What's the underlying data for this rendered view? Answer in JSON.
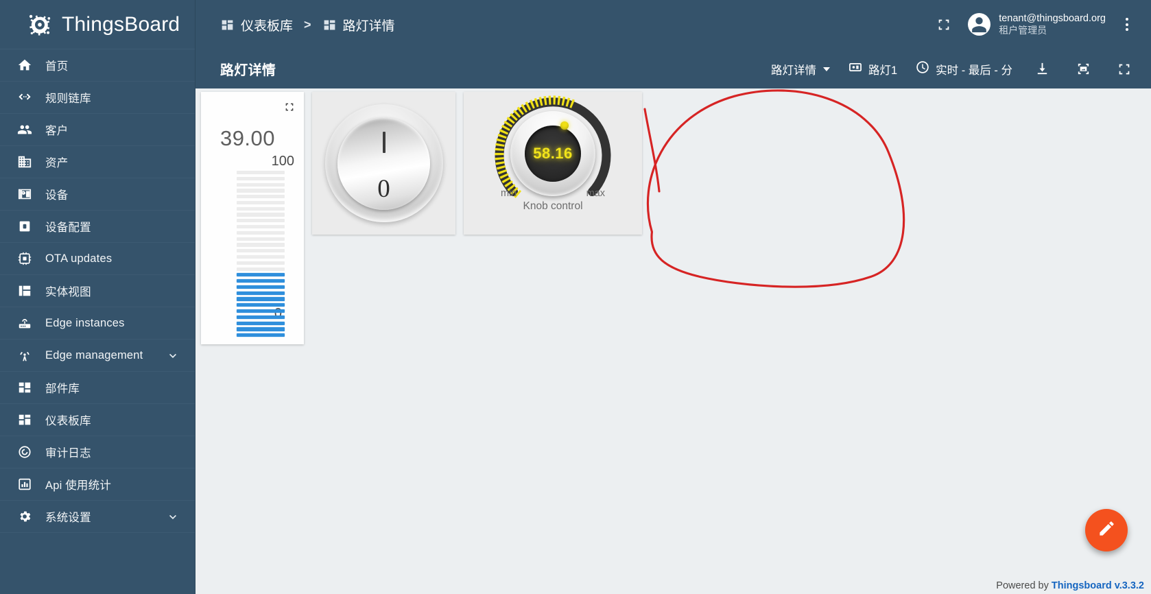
{
  "brand": {
    "name": "ThingsBoard",
    "logo_icon": "thingsboard-gear-logo"
  },
  "sidebar": {
    "items": [
      {
        "label": "首页",
        "icon": "home-icon",
        "expandable": false
      },
      {
        "label": "规则链库",
        "icon": "rule-chain-icon",
        "expandable": false
      },
      {
        "label": "客户",
        "icon": "customers-people-icon",
        "expandable": false
      },
      {
        "label": "资产",
        "icon": "assets-building-icon",
        "expandable": false
      },
      {
        "label": "设备",
        "icon": "devices-icon",
        "expandable": false
      },
      {
        "label": "设备配置",
        "icon": "device-profile-icon",
        "expandable": false
      },
      {
        "label": "OTA updates",
        "icon": "ota-chip-icon",
        "expandable": false
      },
      {
        "label": "实体视图",
        "icon": "entity-view-icon",
        "expandable": false
      },
      {
        "label": "Edge instances",
        "icon": "router-icon",
        "expandable": false
      },
      {
        "label": "Edge management",
        "icon": "edge-antenna-icon",
        "expandable": true
      },
      {
        "label": "部件库",
        "icon": "widget-library-icon",
        "expandable": false
      },
      {
        "label": "仪表板库",
        "icon": "dashboards-icon",
        "expandable": false
      },
      {
        "label": "审计日志",
        "icon": "audit-log-icon",
        "expandable": false
      },
      {
        "label": "Api 使用统计",
        "icon": "api-usage-chart-icon",
        "expandable": false
      },
      {
        "label": "系统设置",
        "icon": "settings-gear-icon",
        "expandable": true
      }
    ]
  },
  "topbar": {
    "breadcrumb": [
      {
        "label": "仪表板库",
        "icon": "dashboards-icon"
      },
      {
        "label": "路灯详情",
        "icon": "dashboards-icon"
      }
    ],
    "separator": ">",
    "fullscreen_icon": "fullscreen-icon",
    "user": {
      "email": "tenant@thingsboard.org",
      "role": "租户管理员",
      "avatar_icon": "account-circle-icon"
    },
    "more_icon": "more-vertical-icon"
  },
  "dashboard_toolbar": {
    "title": "路灯详情",
    "state_select": {
      "label": "路灯详情",
      "icon": "chevron-down-icon"
    },
    "entity": {
      "label": "路灯1",
      "icon": "devices-icon"
    },
    "timewindow": {
      "label": "实时 - 最后 - 分",
      "icon": "clock-icon"
    },
    "actions": [
      {
        "icon": "download-icon",
        "name": "export-dashboard"
      },
      {
        "icon": "image-export-icon",
        "name": "export-image"
      },
      {
        "icon": "fullscreen-icon",
        "name": "fullscreen"
      }
    ]
  },
  "widgets": {
    "led_bar": {
      "name": "LED bar gauge",
      "value": "39.00",
      "max_label": "100",
      "min_label": "0",
      "segments_total": 28,
      "segments_on": 11,
      "on_color": "#2f8fdc",
      "off_color": "#ececec",
      "expand_icon": "expand-widget-icon"
    },
    "round_switch": {
      "name": "Round switch",
      "on_mark": "I",
      "off_mark": "0"
    },
    "knob": {
      "name": "Knob control",
      "title": "Knob control",
      "value": "58.16",
      "min_label": "min",
      "max_label": "max",
      "value_color": "#f2e41a",
      "track_color": "#333333",
      "scale_color": "#f0e016",
      "percent": 58.16
    }
  },
  "annotation": {
    "shape": "hand-drawn-red-circle",
    "color": "#d62424",
    "target": "knob-control-widget"
  },
  "footer": {
    "powered_prefix": "Powered by ",
    "powered_link": "Thingsboard v.3.3.2"
  },
  "fab": {
    "icon": "edit-pencil-icon",
    "name": "edit-dashboard"
  }
}
